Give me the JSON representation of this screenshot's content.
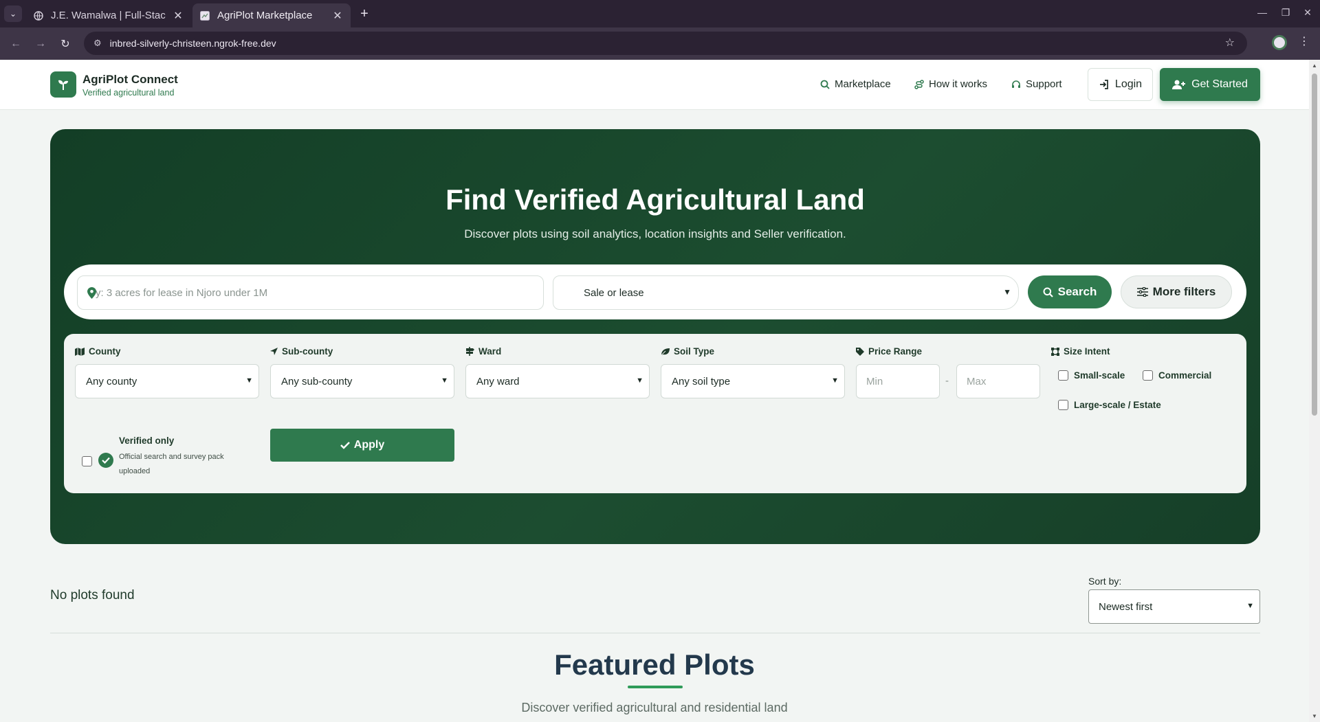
{
  "browser": {
    "tabs": [
      {
        "title": "J.E. Wamalwa | Full-Stac",
        "active": false
      },
      {
        "title": "AgriPlot Marketplace",
        "active": true
      }
    ],
    "url": "inbred-silverly-christeen.ngrok-free.dev"
  },
  "header": {
    "brand_name": "AgriPlot Connect",
    "brand_tagline": "Verified agricultural land",
    "nav": [
      {
        "label": "Marketplace",
        "icon": "search-icon"
      },
      {
        "label": "How it works",
        "icon": "route-icon"
      },
      {
        "label": "Support",
        "icon": "headset-icon"
      }
    ],
    "login_label": "Login",
    "cta_label": "Get Started"
  },
  "hero": {
    "title": "Find Verified Agricultural Land",
    "subtitle": "Discover plots using soil analytics, location insights and Seller verification.",
    "search_placeholder": "y: 3 acres for lease in Njoro under 1M",
    "mode_value": "Sale or lease",
    "search_label": "Search",
    "filters_label": "More filters"
  },
  "filters": {
    "county": {
      "label": "County",
      "value": "Any county"
    },
    "subcounty": {
      "label": "Sub-county",
      "value": "Any sub-county"
    },
    "ward": {
      "label": "Ward",
      "value": "Any ward"
    },
    "soil": {
      "label": "Soil Type",
      "value": "Any soil type"
    },
    "price": {
      "label": "Price Range",
      "min_placeholder": "Min",
      "separator": "-",
      "max_placeholder": "Max"
    },
    "size": {
      "label": "Size Intent",
      "options": [
        "Small-scale",
        "Commercial",
        "Large-scale / Estate"
      ]
    },
    "verified_title": "Verified only",
    "verified_desc": "Official search and survey pack uploaded",
    "apply_label": "Apply"
  },
  "results": {
    "empty_text": "No plots found",
    "sort_label": "Sort by:",
    "sort_value": "Newest first"
  },
  "featured": {
    "title": "Featured Plots",
    "subtitle": "Discover verified agricultural and residential land"
  },
  "colors": {
    "brand": "#2f7a4e",
    "hero_bg": "#1a4a2e",
    "browser_chrome": "#2b2233"
  }
}
